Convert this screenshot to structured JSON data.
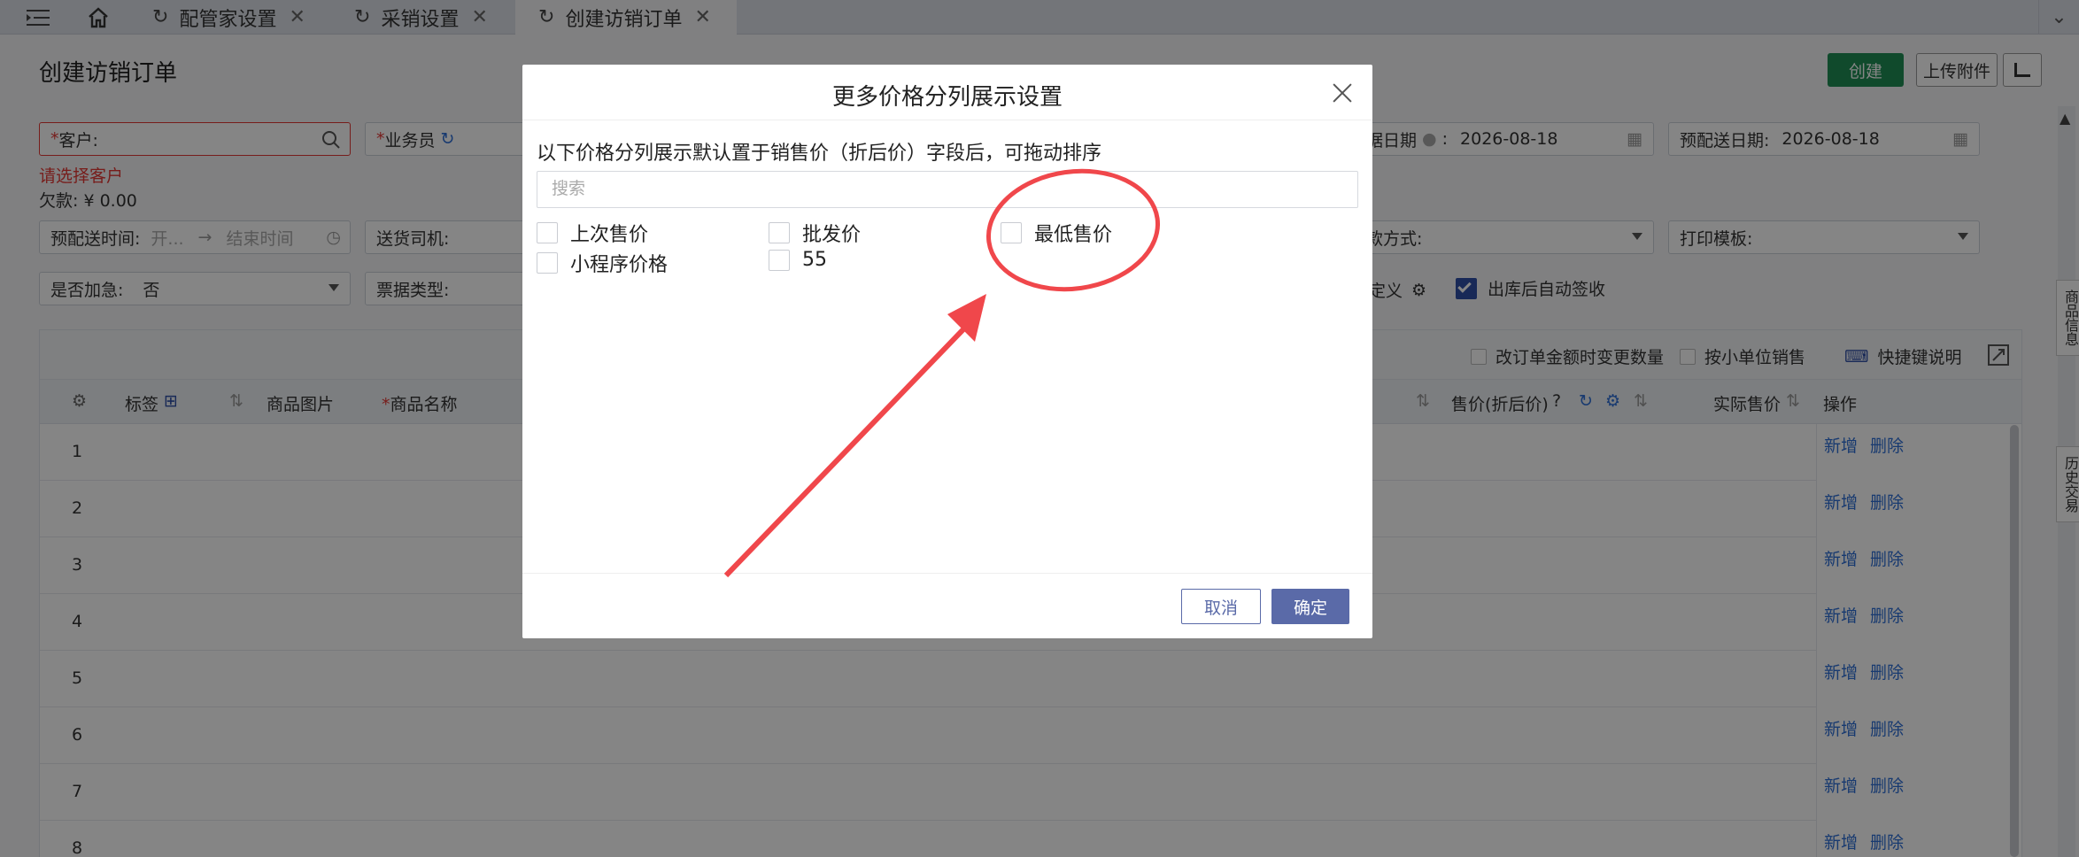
{
  "tabs": [
    {
      "label": "",
      "icon": "menu-collapse-icon"
    },
    {
      "label": "",
      "icon": "home-icon"
    },
    {
      "label": "配管家设置",
      "icon": "refresh-icon"
    },
    {
      "label": "采销设置",
      "icon": "refresh-icon"
    },
    {
      "label": "创建访销订单",
      "icon": "refresh-icon"
    }
  ],
  "page": {
    "title": "创建访销订单",
    "create_label": "创建",
    "upload_label": "上传附件"
  },
  "form": {
    "customer_label": "客户:",
    "customer_error": "请选择客户",
    "owe_label": "欠款: ¥ 0.00",
    "salesman_label": "业务员",
    "doc_date_label": "据日期",
    "doc_date_value": "2026-08-18",
    "pre_delivery_date_label": "预配送日期:",
    "pre_delivery_date_value": "2026-08-18",
    "pre_delivery_time_label": "预配送时间:",
    "start_placeholder": "开...",
    "end_placeholder": "结束时间",
    "driver_label": "送货司机:",
    "payment_label": "款方式:",
    "print_template_label": "打印模板:",
    "urgent_label": "是否加急:",
    "urgent_value": "否",
    "invoice_label": "票据类型:",
    "custom_label": "定义",
    "auto_sign_label": "出库后自动签收"
  },
  "table": {
    "toolbar": {
      "change_qty_label": "改订单金额时变更数量",
      "small_unit_label": "按小单位销售",
      "shortcut_label": "快捷键说明"
    },
    "headers": {
      "tag": "标签",
      "image": "商品图片",
      "name": "商品名称",
      "price": "售价(折后价)",
      "actual_price": "实际售价",
      "ops": "操作"
    },
    "rows": [
      "1",
      "2",
      "3",
      "4",
      "5",
      "6",
      "7",
      "8"
    ],
    "add_label": "新增",
    "delete_label": "删除"
  },
  "side_tabs": {
    "goods_info": "商品信息",
    "history": "历史交易"
  },
  "modal": {
    "title": "更多价格分列展示设置",
    "description": "以下价格分列展示默认置于销售价（折后价）字段后，可拖动排序",
    "search_placeholder": "搜索",
    "options": [
      {
        "label": "上次售价",
        "checked": false
      },
      {
        "label": "批发价",
        "checked": false
      },
      {
        "label": "最低售价",
        "checked": false
      },
      {
        "label": "小程序价格",
        "checked": false
      },
      {
        "label": "55",
        "checked": false
      }
    ],
    "cancel_label": "取消",
    "ok_label": "确定"
  },
  "colors": {
    "accent": "#5a6aa8",
    "create_button": "#1f8f55",
    "error": "#e53935",
    "link": "#2f6fd6",
    "annotation": "#f0474b"
  }
}
